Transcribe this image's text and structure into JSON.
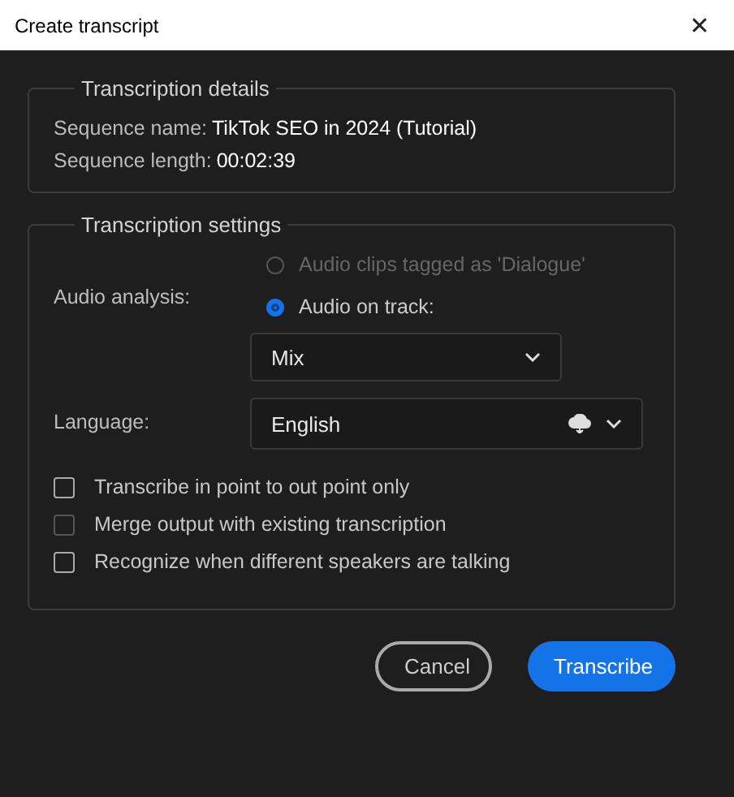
{
  "window": {
    "title": "Create transcript",
    "close": "✕"
  },
  "details": {
    "legend": "Transcription details",
    "fields": [
      {
        "label": "Sequence name:",
        "value": "TikTok SEO in 2024 (Tutorial)"
      },
      {
        "label": "Sequence length:",
        "value": "00:02:39"
      }
    ]
  },
  "settings": {
    "legend": "Transcription settings",
    "audio_label": "Audio analysis:",
    "radios": [
      {
        "label": "Audio clips tagged as 'Dialogue'",
        "selected": false,
        "disabled": true
      },
      {
        "label": "Audio on track:",
        "selected": true,
        "disabled": false
      }
    ],
    "track": {
      "value": "Mix"
    },
    "language_label": "Language:",
    "language": {
      "value": "English"
    },
    "checkboxes": [
      {
        "label": "Transcribe in point to out point only",
        "checked": false,
        "disabled": false
      },
      {
        "label": "Merge output with existing transcription",
        "checked": false,
        "disabled": true
      },
      {
        "label": "Recognize when different speakers are talking",
        "checked": false,
        "disabled": false
      }
    ]
  },
  "buttons": [
    {
      "label": "Cancel",
      "kind": "secondary"
    },
    {
      "label": "Transcribe",
      "kind": "primary"
    }
  ]
}
